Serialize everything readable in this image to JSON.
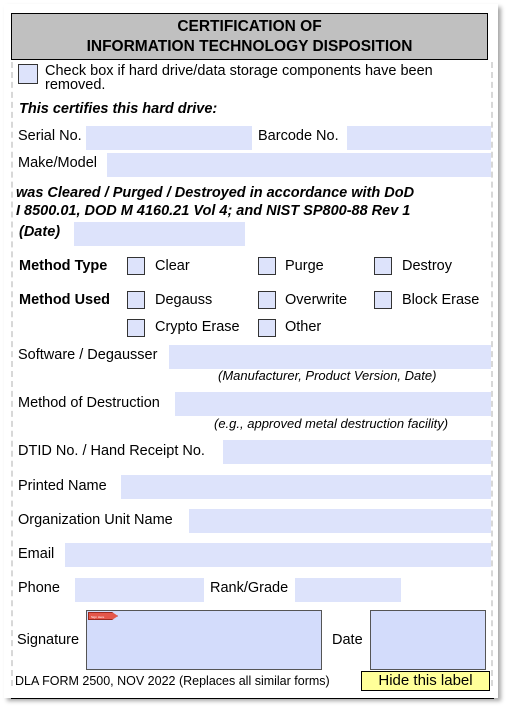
{
  "form": {
    "title_line1": "CERTIFICATION OF",
    "title_line2": "INFORMATION TECHNOLOGY DISPOSITION",
    "removed_checkbox_label_line1": "Check box if hard drive/data storage components have been",
    "removed_checkbox_label_line2": "removed.",
    "certifies_heading": "This certifies this hard drive:",
    "serial_label": "Serial No.",
    "serial_value": "",
    "barcode_label": "Barcode No.",
    "barcode_value": "",
    "make_model_label": "Make/Model",
    "make_model_value": "",
    "statement_line1": "was Cleared / Purged / Destroyed in accordance with DoD",
    "statement_line2": "I 8500.01, DOD M 4160.21 Vol 4; and NIST SP800-88 Rev 1",
    "date_label": "(Date)",
    "date_value": "",
    "method_type": {
      "label": "Method Type",
      "options": [
        {
          "label": "Clear",
          "checked": false
        },
        {
          "label": "Purge",
          "checked": false
        },
        {
          "label": "Destroy",
          "checked": false
        }
      ]
    },
    "method_used": {
      "label": "Method Used",
      "options": [
        {
          "label": "Degauss",
          "checked": false
        },
        {
          "label": "Overwrite",
          "checked": false
        },
        {
          "label": "Block Erase",
          "checked": false
        },
        {
          "label": "Crypto Erase",
          "checked": false
        },
        {
          "label": "Other",
          "checked": false
        }
      ]
    },
    "software_label": "Software / Degausser",
    "software_value": "",
    "software_hint": "(Manufacturer, Product Version, Date)",
    "destruction_label": "Method of Destruction",
    "destruction_value": "",
    "destruction_hint": "(e.g., approved metal destruction facility)",
    "dtid_label": "DTID No. / Hand Receipt No.",
    "dtid_value": "",
    "printed_name_label": "Printed Name",
    "printed_name_value": "",
    "org_unit_label": "Organization Unit Name",
    "org_unit_value": "",
    "email_label": "Email",
    "email_value": "",
    "phone_label": "Phone",
    "phone_value": "",
    "rank_label": "Rank/Grade",
    "rank_value": "",
    "signature_label": "Signature",
    "sign_here_flag": "Sign Here",
    "sign_date_label": "Date",
    "sign_date_value": "",
    "footer_text": "DLA FORM 2500, NOV 2022 (Replaces all similar forms)",
    "hide_label_button": "Hide this label"
  },
  "colors": {
    "field_fill": "#dde3fb",
    "header_fill": "#c0c0c0",
    "hide_button_fill": "#ffff99",
    "sign_flag": "#e5574a"
  }
}
